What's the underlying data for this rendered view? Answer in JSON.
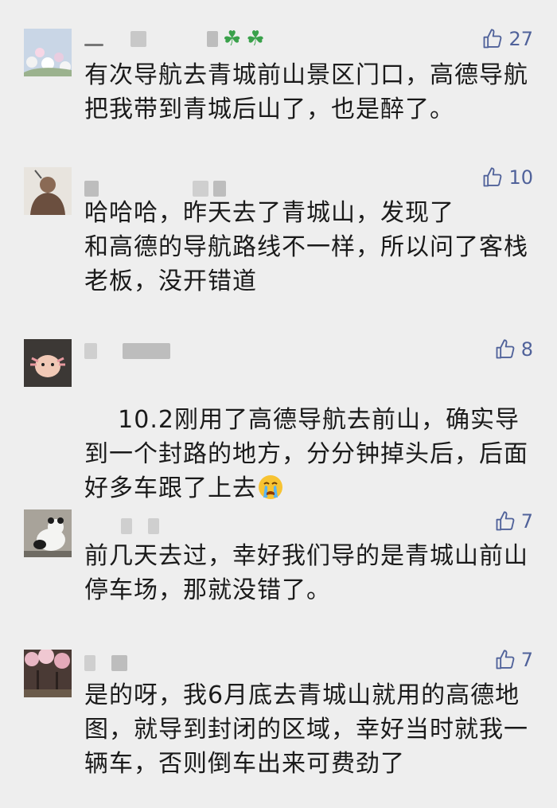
{
  "comments": [
    {
      "likes": "27",
      "text": "有次导航去青城前山景区门口，高德导航把我带到青城后山了，也是醉了。"
    },
    {
      "likes": "10",
      "text": "哈哈哈，昨天去了青城山，发现了\n和高德的导航路线不一样，所以问了客栈老板，没开错道"
    },
    {
      "likes": "8",
      "text": "10.2刚用了高德导航去前山，确实导到一个封路的地方，分分钟掉头后，后面好多车跟了上去"
    },
    {
      "likes": "7",
      "text": "前几天去过，幸好我们导的是青城山前山停车场，那就没错了。"
    },
    {
      "likes": "7",
      "text": "是的呀，我6月底去青城山就用的高德地图，就导到封闭的区域，幸好当时就我一辆车，否则倒车出来可费劲了"
    }
  ],
  "icons": {
    "like": "thumbs-up-icon",
    "emoji": "crying-face-icon"
  },
  "colors": {
    "background": "#eeeeee",
    "like_color": "#50629a",
    "text_color": "#1a1a1a"
  }
}
